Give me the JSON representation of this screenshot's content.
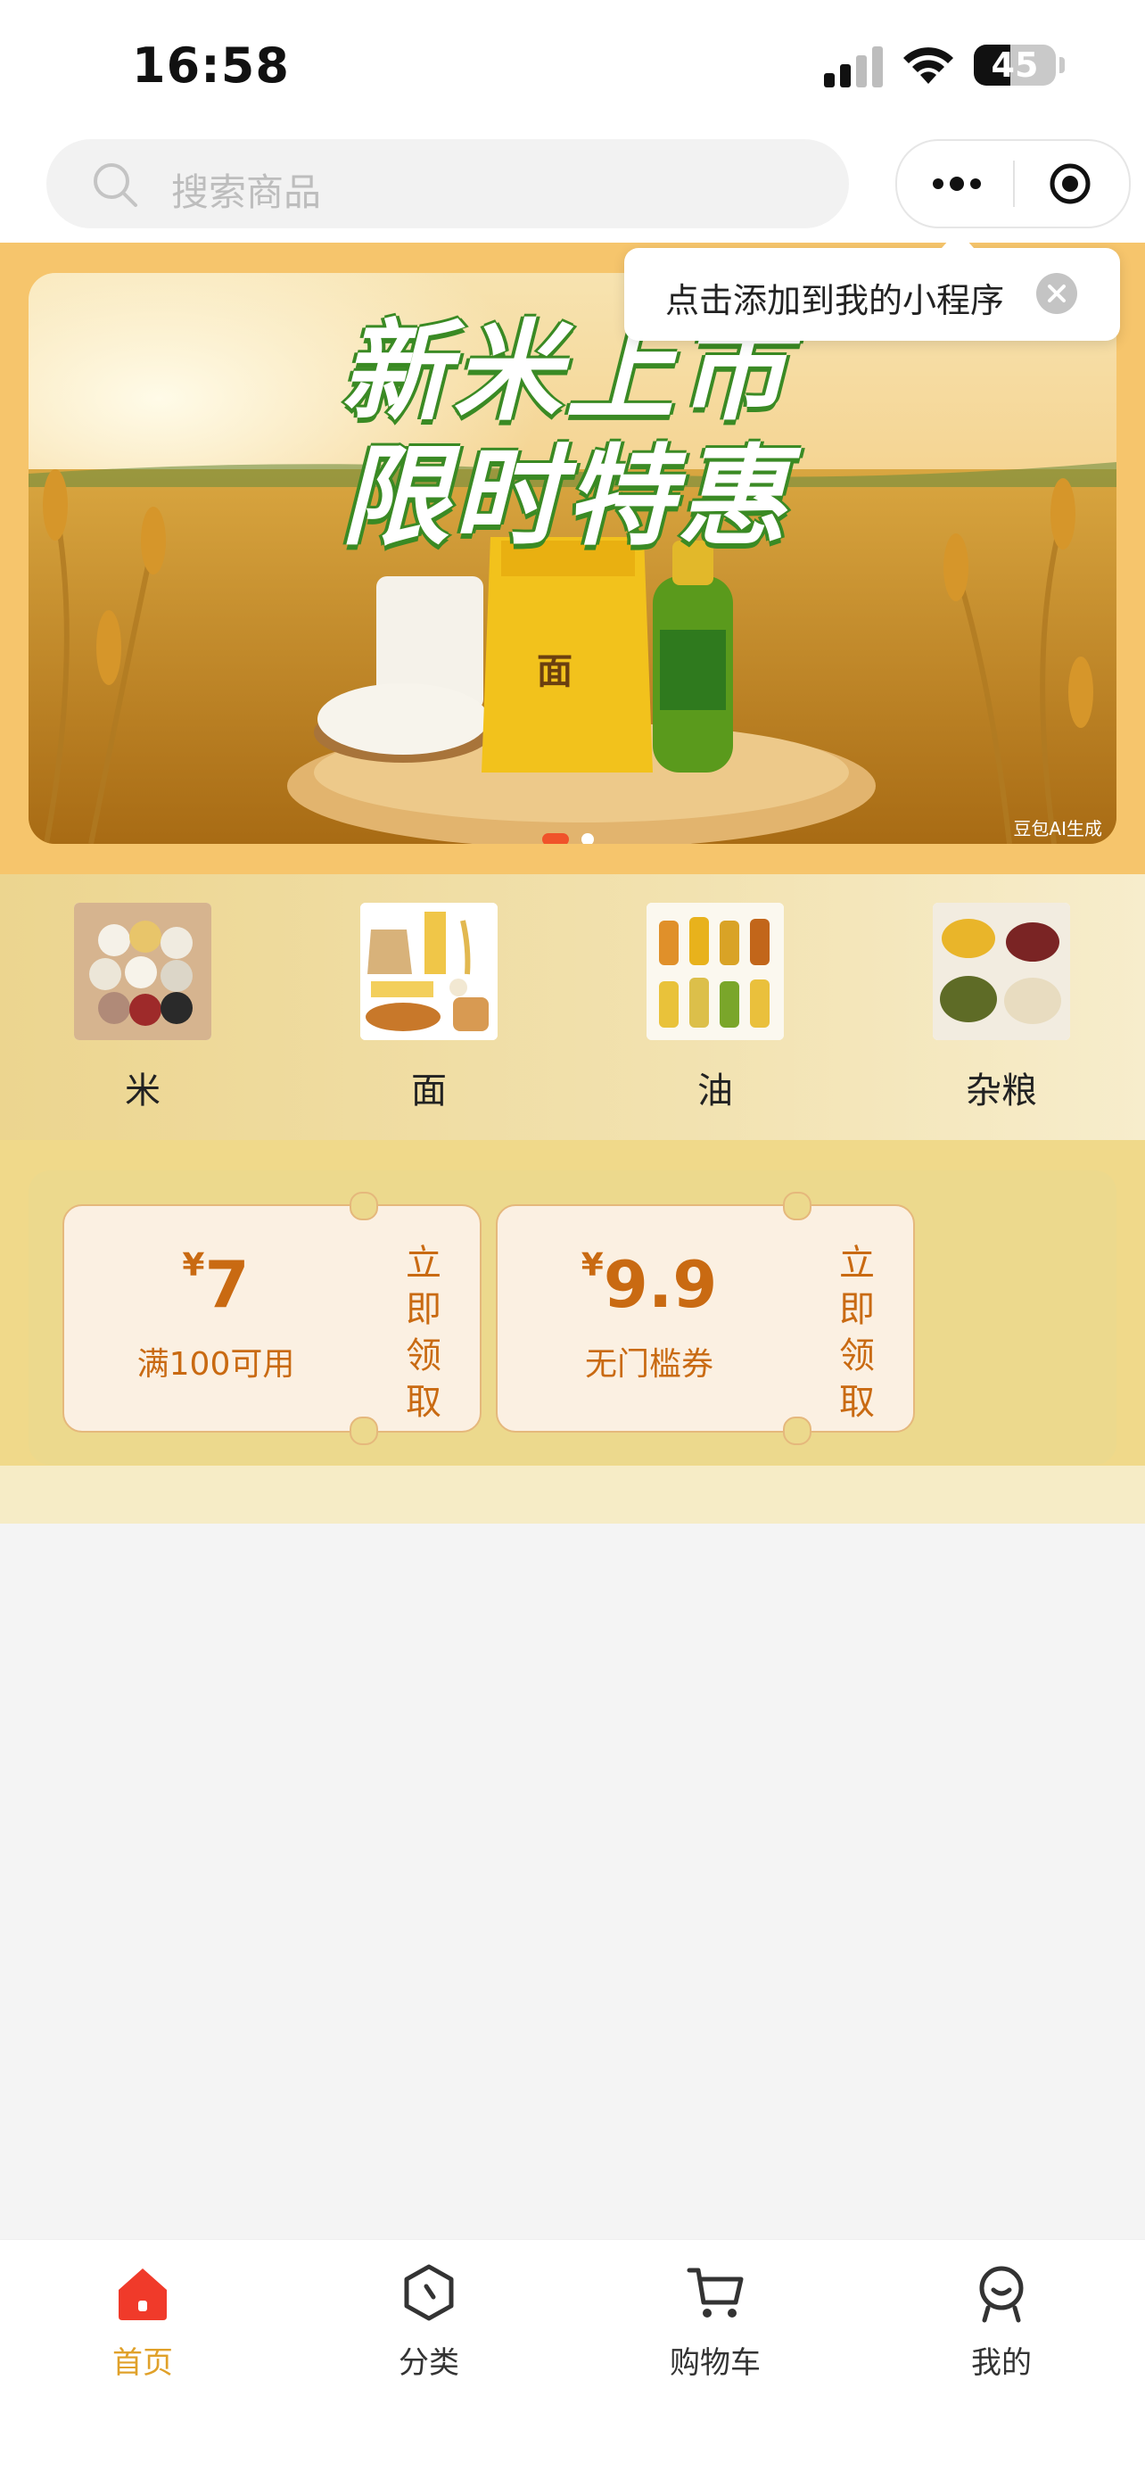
{
  "status": {
    "time": "16:58",
    "battery": "45",
    "battery_level": 0.45
  },
  "search": {
    "placeholder": "搜索商品"
  },
  "tooltip": {
    "text": "点击添加到我的小程序"
  },
  "banner": {
    "line1": "新米上市",
    "line2": "限时特惠",
    "watermark": "豆包AI生成",
    "active_index": 0,
    "count": 2
  },
  "categories": [
    {
      "label": "米",
      "icon": "rice-grains-image"
    },
    {
      "label": "面",
      "icon": "flour-bread-image"
    },
    {
      "label": "油",
      "icon": "cooking-oil-image"
    },
    {
      "label": "杂粮",
      "icon": "mixed-grains-image"
    }
  ],
  "coupons": [
    {
      "currency": "¥",
      "amount": "7",
      "condition": "满100可用",
      "action": [
        "立",
        "即",
        "领",
        "取"
      ]
    },
    {
      "currency": "¥",
      "amount": "9.9",
      "condition": "无门槛券",
      "action": [
        "立",
        "即",
        "领",
        "取"
      ]
    }
  ],
  "tabbar": [
    {
      "label": "首页",
      "icon": "home-icon",
      "active": true
    },
    {
      "label": "分类",
      "icon": "category-icon",
      "active": false
    },
    {
      "label": "购物车",
      "icon": "cart-icon",
      "active": false
    },
    {
      "label": "我的",
      "icon": "profile-icon",
      "active": false
    }
  ],
  "colors": {
    "accent": "#e0a12a",
    "coupon_text": "#c96a12",
    "banner_bg": "#f6c56c",
    "home_red": "#f03a2a"
  }
}
